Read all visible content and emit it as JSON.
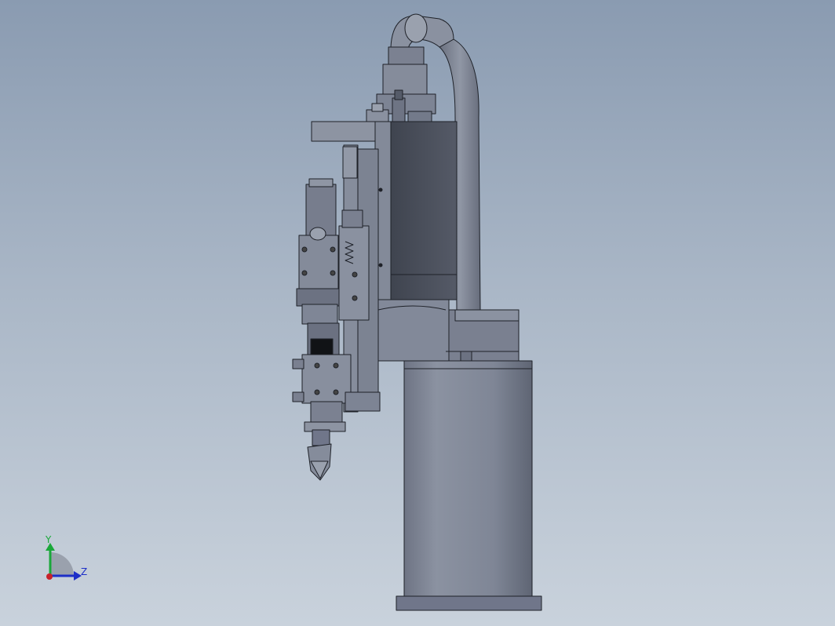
{
  "triad": {
    "y_label": "Y",
    "z_label": "Z",
    "colors": {
      "y": "#1aa83a",
      "z": "#1d2fc8",
      "x": "#c8222a"
    }
  },
  "palette": {
    "background_top": "#8a9bb1",
    "background_bottom": "#c9d2dc",
    "body": "#7b8190",
    "body_light": "#8e95a4",
    "dark_block": "#4a4f5c",
    "outline": "#1e2128"
  }
}
